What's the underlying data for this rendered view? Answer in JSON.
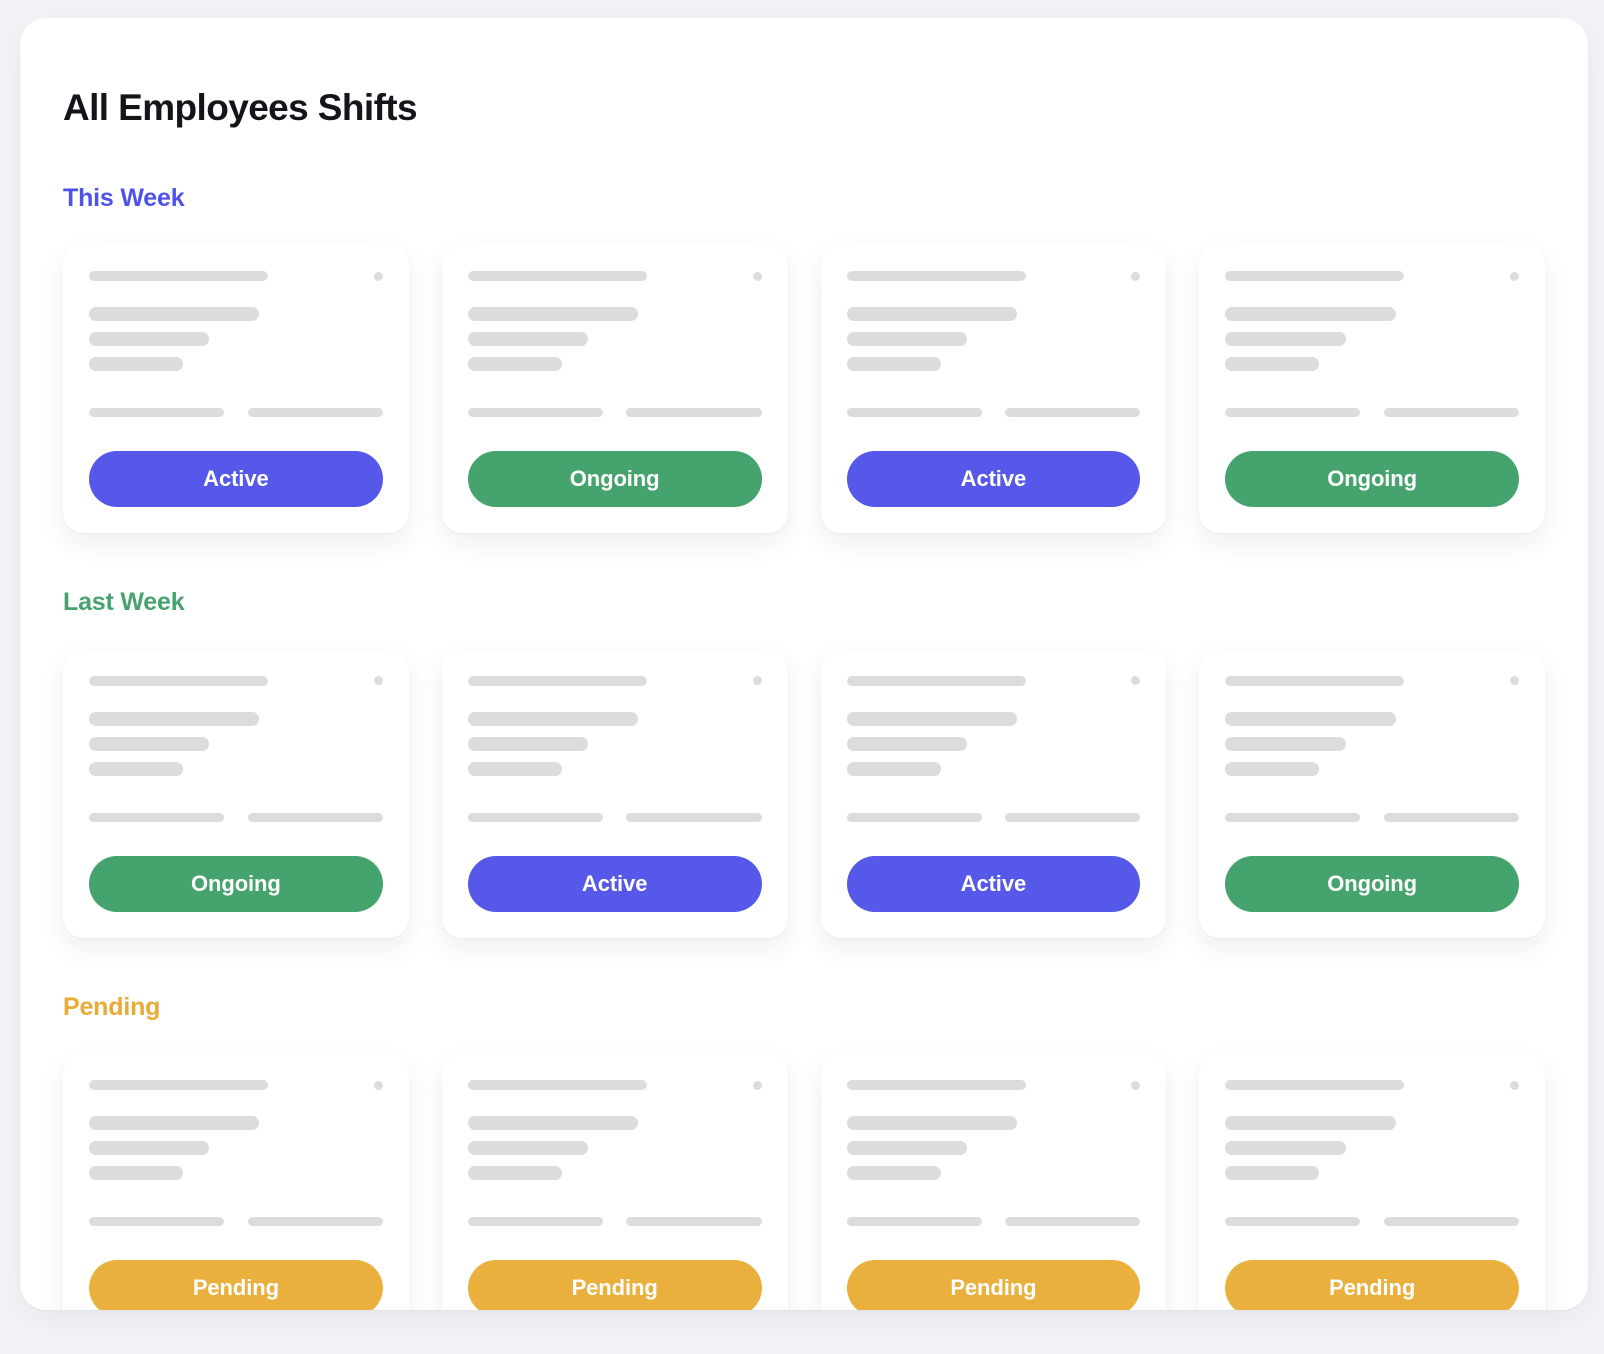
{
  "page": {
    "title": "All Employees Shifts",
    "background_color": "#f1f3f7",
    "surface_color": "#ffffff"
  },
  "status_colors": {
    "active": "#5558e8",
    "ongoing": "#45a36d",
    "pending": "#eab03e",
    "skeleton": "#dcdcdc"
  },
  "sections": [
    {
      "title": "This Week",
      "accent": "#4f52e8",
      "accent_class": "accent-indigo",
      "cards": [
        {
          "status_label": "Active",
          "status_class": "active"
        },
        {
          "status_label": "Ongoing",
          "status_class": "ongoing"
        },
        {
          "status_label": "Active",
          "status_class": "active"
        },
        {
          "status_label": "Ongoing",
          "status_class": "ongoing"
        }
      ]
    },
    {
      "title": "Last Week",
      "accent": "#46a36d",
      "accent_class": "accent-green",
      "cards": [
        {
          "status_label": "Ongoing",
          "status_class": "ongoing"
        },
        {
          "status_label": "Active",
          "status_class": "active"
        },
        {
          "status_label": "Active",
          "status_class": "active"
        },
        {
          "status_label": "Ongoing",
          "status_class": "ongoing"
        }
      ]
    },
    {
      "title": "Pending",
      "accent": "#e7ab38",
      "accent_class": "accent-amber",
      "cards": [
        {
          "status_label": "Pending",
          "status_class": "pending"
        },
        {
          "status_label": "Pending",
          "status_class": "pending"
        },
        {
          "status_label": "Pending",
          "status_class": "pending"
        },
        {
          "status_label": "Pending",
          "status_class": "pending"
        }
      ]
    }
  ]
}
